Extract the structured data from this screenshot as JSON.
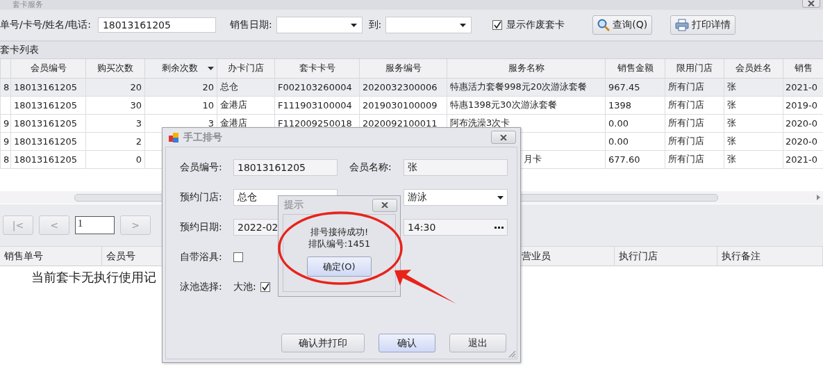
{
  "window": {
    "title": "套卡服务"
  },
  "search": {
    "label": "单号/卡号/姓名/电话:",
    "value": "18013161205",
    "date_label": "销售日期:",
    "to_label": "到:",
    "show_void": {
      "label": "显示作废套卡",
      "checked": true
    },
    "buttons": [
      {
        "label": "查询(Q)",
        "kind": "search"
      },
      {
        "label": "打印详情",
        "kind": "print"
      }
    ]
  },
  "card_list": {
    "title": "套卡列表",
    "columns": [
      {
        "sorted": false
      },
      {
        "label": "会员编号",
        "sorted": false
      },
      {
        "label": "购买次数",
        "sorted": false
      },
      {
        "label": "剩余次数",
        "sorted": true
      },
      {
        "label": "办卡门店",
        "sorted": false
      },
      {
        "label": "套卡卡号",
        "sorted": false
      },
      {
        "label": "服务编号",
        "sorted": false
      },
      {
        "label": "服务名称",
        "sorted": false
      },
      {
        "label": "销售金额",
        "sorted": false
      },
      {
        "label": "限用门店",
        "sorted": false
      },
      {
        "label": "会员姓名",
        "sorted": false
      },
      {
        "label": "销售",
        "sorted": false
      }
    ],
    "rows": [
      {
        "selected": true,
        "cells": [
          "8",
          "18013161205",
          "20",
          "20",
          "总仓",
          "F002103260004",
          "2020032300006",
          "特惠活力套餐998元20次游泳套餐",
          "967.45",
          "所有门店",
          "张",
          "2021-0"
        ]
      },
      {
        "selected": false,
        "cells": [
          null,
          "18013161205",
          "30",
          "10",
          "金港店",
          "F111903100004",
          "2019030100009",
          "特惠1398元30次游泳套餐",
          "1398",
          "所有门店",
          "张",
          "2019-0"
        ]
      },
      {
        "selected": false,
        "cells": [
          "9",
          "18013161205",
          "3",
          "3",
          "金港店",
          "F112009250018",
          "2020092100011",
          "阿布洗澡3次卡",
          "0.00",
          "所有门店",
          "张",
          "2020-0"
        ]
      },
      {
        "selected": false,
        "cells": [
          "9",
          "18013161205",
          "2",
          null,
          null,
          null,
          null,
          null,
          "0.00",
          "所有门店",
          "张",
          "2020-0"
        ]
      },
      {
        "selected": false,
        "cells": [
          "8",
          "18013161205",
          "0",
          null,
          null,
          null,
          null,
          {
            "text": "月卡",
            "cut": true
          },
          "677.60",
          "所有门店",
          "张",
          "2021-0"
        ]
      }
    ]
  },
  "pager": {
    "buttons": [
      "|<",
      "<",
      ">"
    ],
    "page": "1"
  },
  "usage": {
    "columns": [
      "销售单号",
      "会员号",
      "营业员",
      "执行门店",
      "执行备注"
    ],
    "empty_text": "当前套卡无执行使用记"
  },
  "queue_dialog": {
    "title": "手工排号",
    "member_no": {
      "label": "会员编号:",
      "value": "18013161205"
    },
    "member_name": {
      "label": "会员名称:",
      "value": "张"
    },
    "store": {
      "label": "预约门店:",
      "value": "总仓"
    },
    "item": {
      "value": "游泳"
    },
    "date": {
      "label": "预约日期:",
      "value": "2022-02"
    },
    "time": {
      "value": "14:30"
    },
    "own_towel": {
      "label": "自带浴具:",
      "checked": false
    },
    "pool": {
      "label": "泳池选择:",
      "option": "大池:",
      "checked": true
    },
    "buttons": [
      {
        "label": "确认并打印",
        "default": false
      },
      {
        "label": "确认",
        "default": true
      },
      {
        "label": "退出",
        "default": false
      }
    ]
  },
  "prompt": {
    "title": "提示",
    "message": [
      "排号接待成功!",
      "排队编号:1451"
    ],
    "button": "确定(O)"
  }
}
